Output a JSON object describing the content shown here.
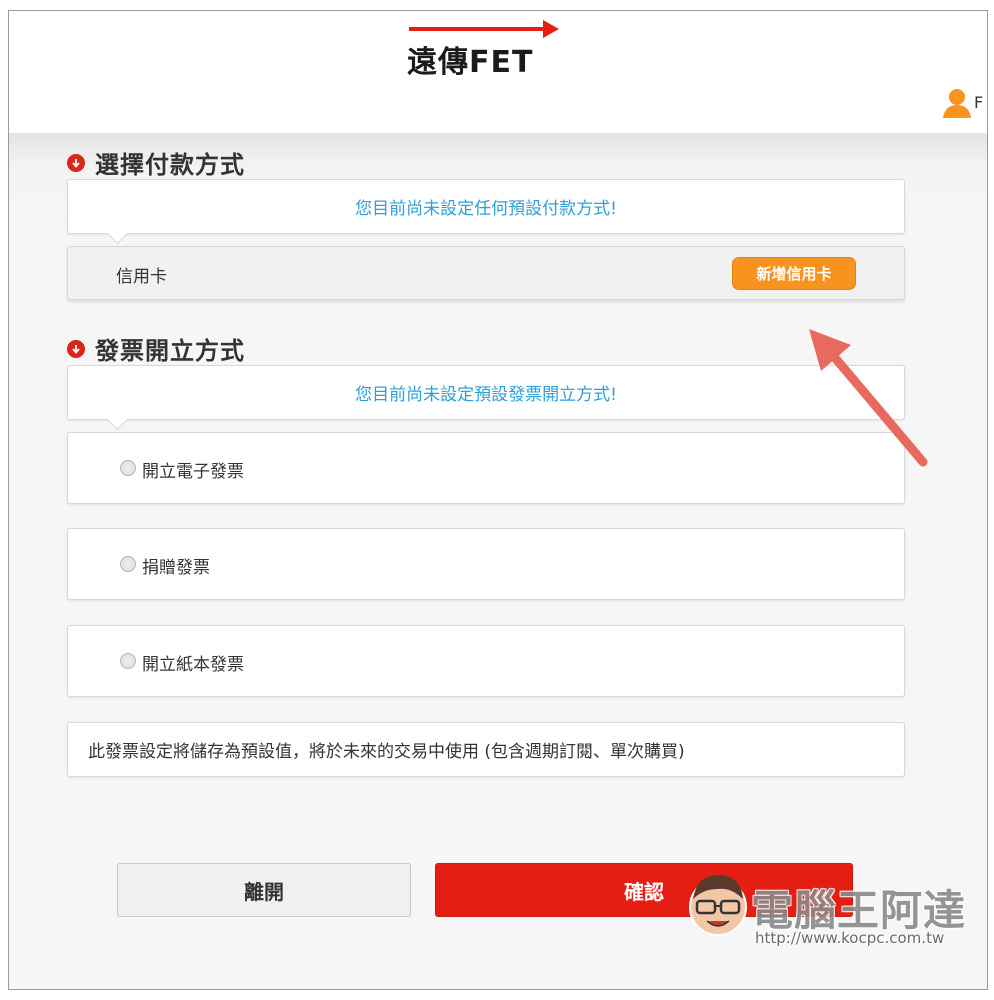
{
  "header": {
    "logo_text": "遠傳FET",
    "user_initial": "F"
  },
  "payment": {
    "title": "選擇付款方式",
    "notice": "您目前尚未設定任何預設付款方式!",
    "method_label": "信用卡",
    "add_card_label": "新增信用卡"
  },
  "invoice": {
    "title": "發票開立方式",
    "notice": "您目前尚未設定預設發票開立方式!",
    "options": [
      {
        "label": "開立電子發票",
        "selected": false
      },
      {
        "label": "捐贈發票",
        "selected": false
      },
      {
        "label": "開立紙本發票",
        "selected": false
      }
    ],
    "note": "此發票設定將儲存為預設值，將於未來的交易中使用 (包含週期訂閱、單次購買)"
  },
  "actions": {
    "leave_label": "離開",
    "confirm_label": "確認"
  },
  "watermark": {
    "title": "電腦王阿達",
    "url": "http://www.kocpc.com.tw"
  },
  "colors": {
    "brand_red": "#e41e13",
    "accent_orange": "#f7931e",
    "link_blue": "#2f9fd8",
    "annotation_arrow": "#e8695e"
  }
}
